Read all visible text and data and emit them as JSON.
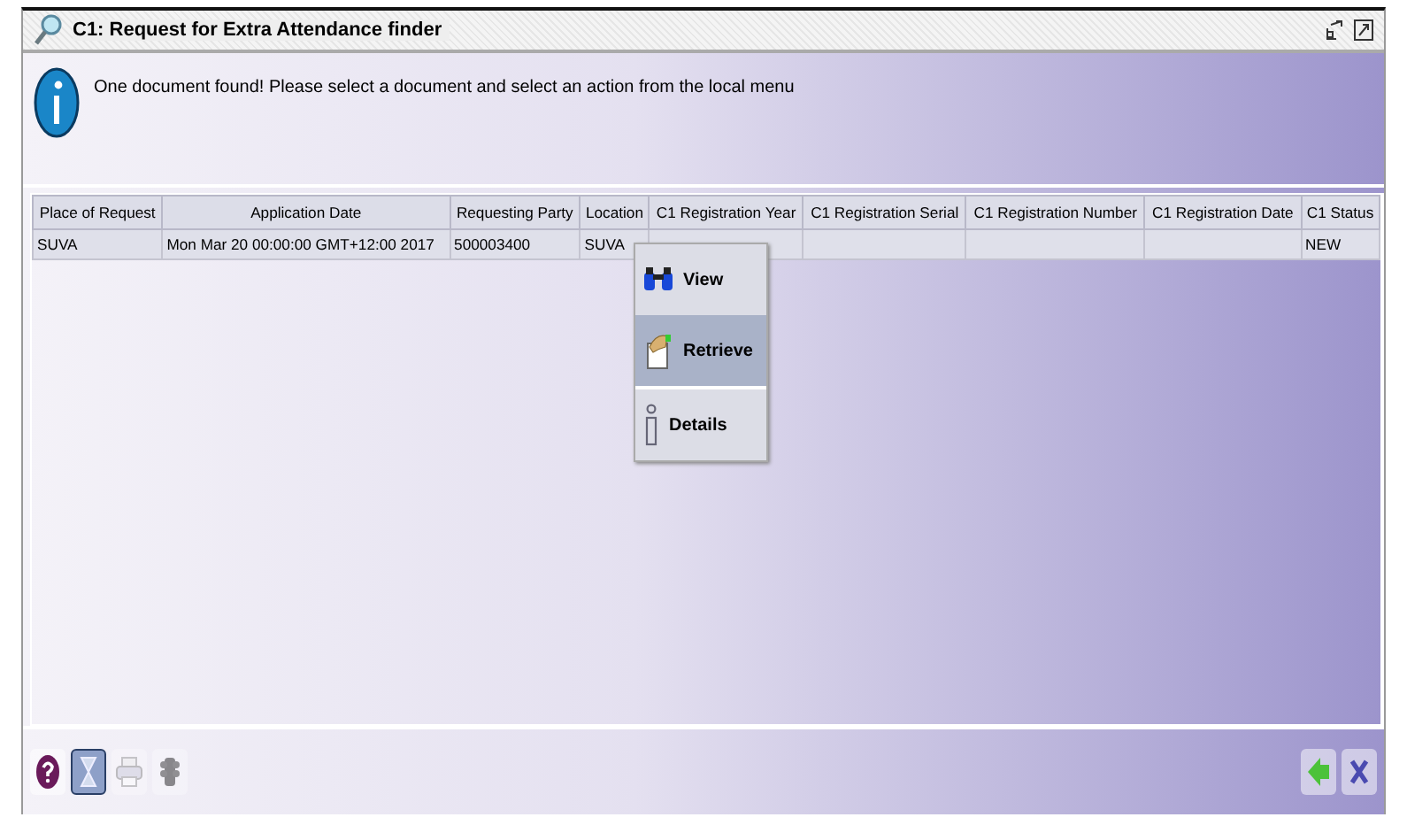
{
  "window": {
    "title": "C1: Request for Extra Attendance finder"
  },
  "message": "One document found! Please select a document and select an action from the local menu",
  "table": {
    "columns": [
      "Place of Request",
      "Application Date",
      "Requesting Party",
      "Location",
      "C1 Registration Year",
      "C1 Registration Serial",
      "C1 Registration Number",
      "C1 Registration Date",
      "C1 Status"
    ],
    "rows": [
      [
        "SUVA",
        "Mon Mar 20 00:00:00 GMT+12:00 2017",
        "500003400",
        "SUVA",
        "",
        "",
        "",
        "",
        "NEW"
      ]
    ]
  },
  "context_menu": {
    "groups": [
      {
        "items": [
          {
            "kind": "view",
            "label": "View",
            "selected": false
          },
          {
            "kind": "retrieve",
            "label": "Retrieve",
            "selected": true
          }
        ]
      },
      {
        "items": [
          {
            "kind": "details",
            "label": "Details",
            "selected": false
          }
        ]
      }
    ]
  },
  "toolbar": {
    "left": [
      {
        "kind": "help",
        "selected": false,
        "disabled": false
      },
      {
        "kind": "hourglass",
        "selected": true,
        "disabled": false
      },
      {
        "kind": "print",
        "selected": false,
        "disabled": true
      },
      {
        "kind": "traffic",
        "selected": false,
        "disabled": true
      }
    ],
    "right": [
      {
        "kind": "back",
        "selected": false,
        "disabled": false
      },
      {
        "kind": "close",
        "selected": false,
        "disabled": false
      }
    ]
  }
}
